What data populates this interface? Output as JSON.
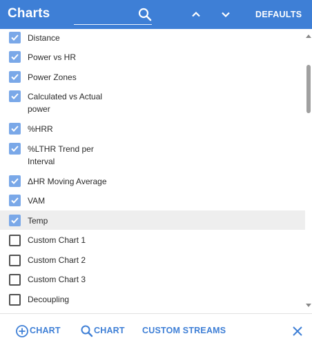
{
  "header": {
    "title": "Charts",
    "defaults_label": "DEFAULTS"
  },
  "list": {
    "items": [
      {
        "label": "Distance",
        "checked": true
      },
      {
        "label": "Power vs HR",
        "checked": true
      },
      {
        "label": "Power Zones",
        "checked": true
      },
      {
        "label": "Calculated vs Actual power",
        "checked": true
      },
      {
        "label": "%HRR",
        "checked": true
      },
      {
        "label": "%LTHR Trend per Interval",
        "checked": true
      },
      {
        "label": "ΔHR Moving Average",
        "checked": true
      },
      {
        "label": "VAM",
        "checked": true
      },
      {
        "label": "Temp",
        "checked": true,
        "highlighted": true
      },
      {
        "label": "Custom Chart 1",
        "checked": false
      },
      {
        "label": "Custom Chart 2",
        "checked": false
      },
      {
        "label": "Custom Chart 3",
        "checked": false
      },
      {
        "label": "Decoupling",
        "checked": false
      }
    ]
  },
  "footer": {
    "add_chart_label": "CHART",
    "search_chart_label": "CHART",
    "custom_streams_label": "CUSTOM STREAMS"
  },
  "colors": {
    "accent": "#3e7fd6",
    "checkbox_checked": "#7aa8e8",
    "highlight": "#eeeeee"
  }
}
